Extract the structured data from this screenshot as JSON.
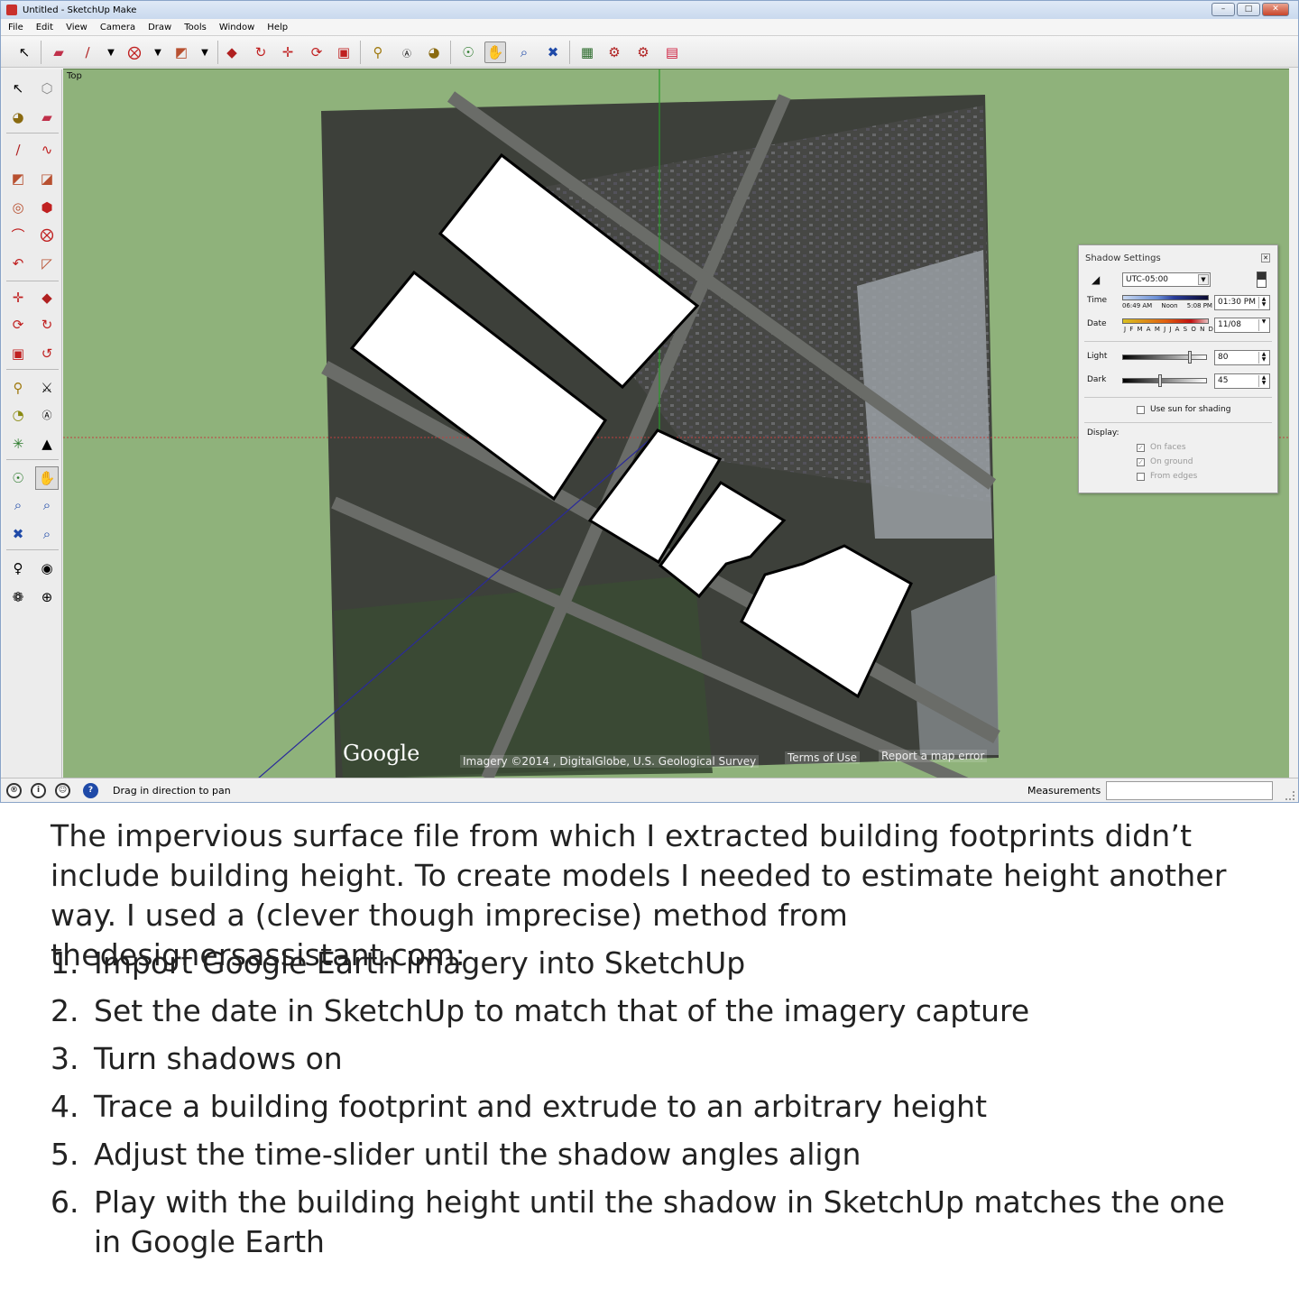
{
  "window": {
    "title": "Untitled - SketchUp Make",
    "controls": {
      "minimize": "–",
      "maximize": "□",
      "close": "✕"
    }
  },
  "menu": [
    "File",
    "Edit",
    "View",
    "Camera",
    "Draw",
    "Tools",
    "Window",
    "Help"
  ],
  "viewport": {
    "view_label": "Top",
    "imagery_brand": "Google",
    "imagery_credit": "Imagery ©2014 , DigitalGlobe, U.S. Geological Survey",
    "terms_link": "Terms of Use",
    "report_link": "Report a map error"
  },
  "shadow_settings": {
    "title": "Shadow Settings",
    "timezone": "UTC-05:00",
    "time_label": "Time",
    "time_ticks": [
      "06:49 AM",
      "Noon",
      "5:08 PM"
    ],
    "time_value": "01:30 PM",
    "date_label": "Date",
    "date_ticks": "J F M A M J J A S O N D",
    "date_value": "11/08",
    "light_label": "Light",
    "light_value": "80",
    "dark_label": "Dark",
    "dark_value": "45",
    "use_sun_label": "Use sun for shading",
    "display_label": "Display:",
    "on_faces_label": "On faces",
    "on_ground_label": "On ground",
    "from_edges_label": "From edges",
    "light_level": 0.8,
    "dark_level": 0.45
  },
  "status": {
    "hint": "Drag in direction to pan",
    "measurements_label": "Measurements",
    "measurements_value": ""
  },
  "caption": {
    "intro": "The impervious surface file from which I extracted building footprints didn’t include building height. To create models I needed to estimate height another way. I used a (clever though imprecise) method from thedesignersassistant.com:",
    "steps": [
      {
        "num": "1.",
        "text": "Import Google Earth imagery into SketchUp"
      },
      {
        "num": "2.",
        "text": "Set the date in SketchUp to match that of the imagery capture"
      },
      {
        "num": "3.",
        "text": "Turn shadows on"
      },
      {
        "num": "4.",
        "text": "Trace a building footprint and extrude to an arbitrary height"
      },
      {
        "num": "5.",
        "text": "Adjust the time-slider until the shadow angles align"
      },
      {
        "num": "6.",
        "text": "Play with the building height until the shadow in SketchUp matches the one in Google Earth"
      }
    ]
  },
  "colors": {
    "viewport_bg": "#8fb27b",
    "red_axis": "#c04040",
    "green_axis": "#2a9a2a",
    "blue_axis": "#2a2a9a"
  }
}
